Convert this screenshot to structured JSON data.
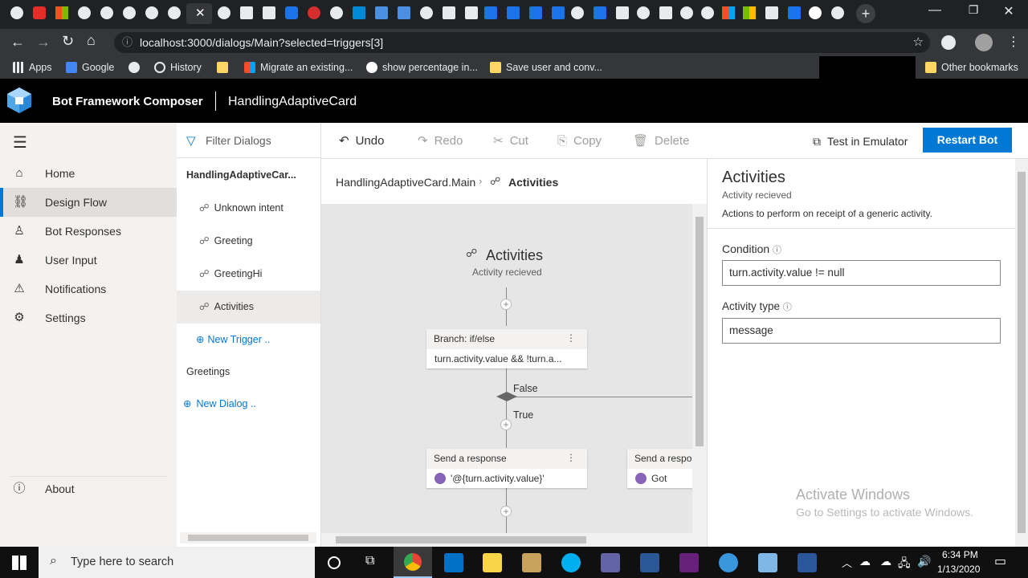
{
  "browser": {
    "url": "localhost:3000/dialogs/Main?selected=triggers[3]",
    "bookmarks": [
      "Apps",
      "Google",
      "History",
      "Migrate an existing...",
      "show percentage in...",
      "Save user and conv..."
    ],
    "other_bookmarks": "Other bookmarks"
  },
  "app": {
    "name": "Bot Framework Composer",
    "project": "HandlingAdaptiveCard"
  },
  "nav": {
    "items": [
      {
        "label": "Home",
        "icon": "home-icon"
      },
      {
        "label": "Design Flow",
        "icon": "design-flow-icon"
      },
      {
        "label": "Bot Responses",
        "icon": "bot-responses-icon"
      },
      {
        "label": "User Input",
        "icon": "user-input-icon"
      },
      {
        "label": "Notifications",
        "icon": "warning-icon"
      },
      {
        "label": "Settings",
        "icon": "gear-icon"
      }
    ],
    "about": "About"
  },
  "dialogs": {
    "filter": "Filter Dialogs",
    "main": "HandlingAdaptiveCar...",
    "triggers": [
      "Unknown intent",
      "Greeting",
      "GreetingHi",
      "Activities"
    ],
    "new_trigger": "New Trigger ..",
    "other": "Greetings",
    "new_dialog": "New Dialog .."
  },
  "toolbar": {
    "undo": "Undo",
    "redo": "Redo",
    "cut": "Cut",
    "copy": "Copy",
    "delete": "Delete",
    "test": "Test in Emulator",
    "restart": "Restart Bot"
  },
  "breadcrumb": {
    "root": "HandlingAdaptiveCard.Main",
    "current": "Activities"
  },
  "flow": {
    "title": "Activities",
    "subtitle": "Activity recieved",
    "branch": {
      "header": "Branch: if/else",
      "condition": "turn.activity.value && !turn.a..."
    },
    "false_label": "False",
    "true_label": "True",
    "resp1": {
      "header": "Send a response",
      "text": "'@{turn.activity.value}'"
    },
    "resp2": {
      "header": "Send a respor",
      "text": "Got"
    }
  },
  "panel": {
    "title": "Activities",
    "subtitle": "Activity recieved",
    "desc": "Actions to perform on receipt of a generic activity.",
    "condition_label": "Condition",
    "condition_value": "turn.activity.value != null",
    "type_label": "Activity type",
    "type_value": "message"
  },
  "watermark": {
    "title": "Activate Windows",
    "sub": "Go to Settings to activate Windows."
  },
  "taskbar": {
    "search": "Type here to search",
    "time": "6:34 PM",
    "date": "1/13/2020"
  },
  "colors": {
    "accent": "#0078d4",
    "header": "#000000",
    "chrome": "#35363a"
  }
}
